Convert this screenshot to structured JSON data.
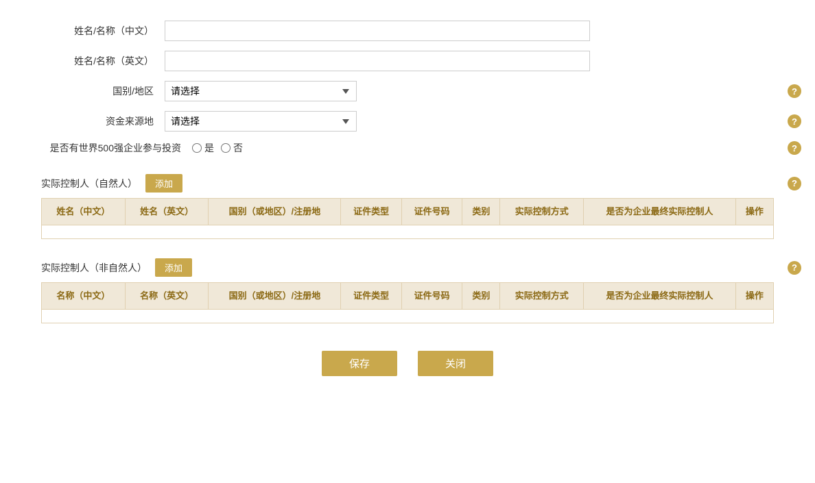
{
  "form": {
    "name_cn_label": "姓名/名称（中文）",
    "name_cn_placeholder": "",
    "name_en_label": "姓名/名称（英文）",
    "name_en_placeholder": "",
    "country_label": "国别/地区",
    "country_placeholder": "请选择",
    "fund_source_label": "资金来源地",
    "fund_source_placeholder": "请选择",
    "fortune500_label": "是否有世界500强企业参与投资",
    "radio_yes": "是",
    "radio_no": "否"
  },
  "natural_person_section": {
    "title": "实际控制人（自然人）",
    "add_btn": "添加",
    "help": "?",
    "columns": [
      "姓名（中文）",
      "姓名（英文）",
      "国别（或地区）/注册地",
      "证件类型",
      "证件号码",
      "类别",
      "实际控制方式",
      "是否为企业最终实际控制人",
      "操作"
    ]
  },
  "non_natural_person_section": {
    "title": "实际控制人（非自然人）",
    "add_btn": "添加",
    "help": "?",
    "columns": [
      "名称（中文）",
      "名称（英文）",
      "国别（或地区）/注册地",
      "证件类型",
      "证件号码",
      "类别",
      "实际控制方式",
      "是否为企业最终实际控制人",
      "操作"
    ]
  },
  "actions": {
    "save_label": "保存",
    "close_label": "关闭"
  },
  "help_icon": "?"
}
